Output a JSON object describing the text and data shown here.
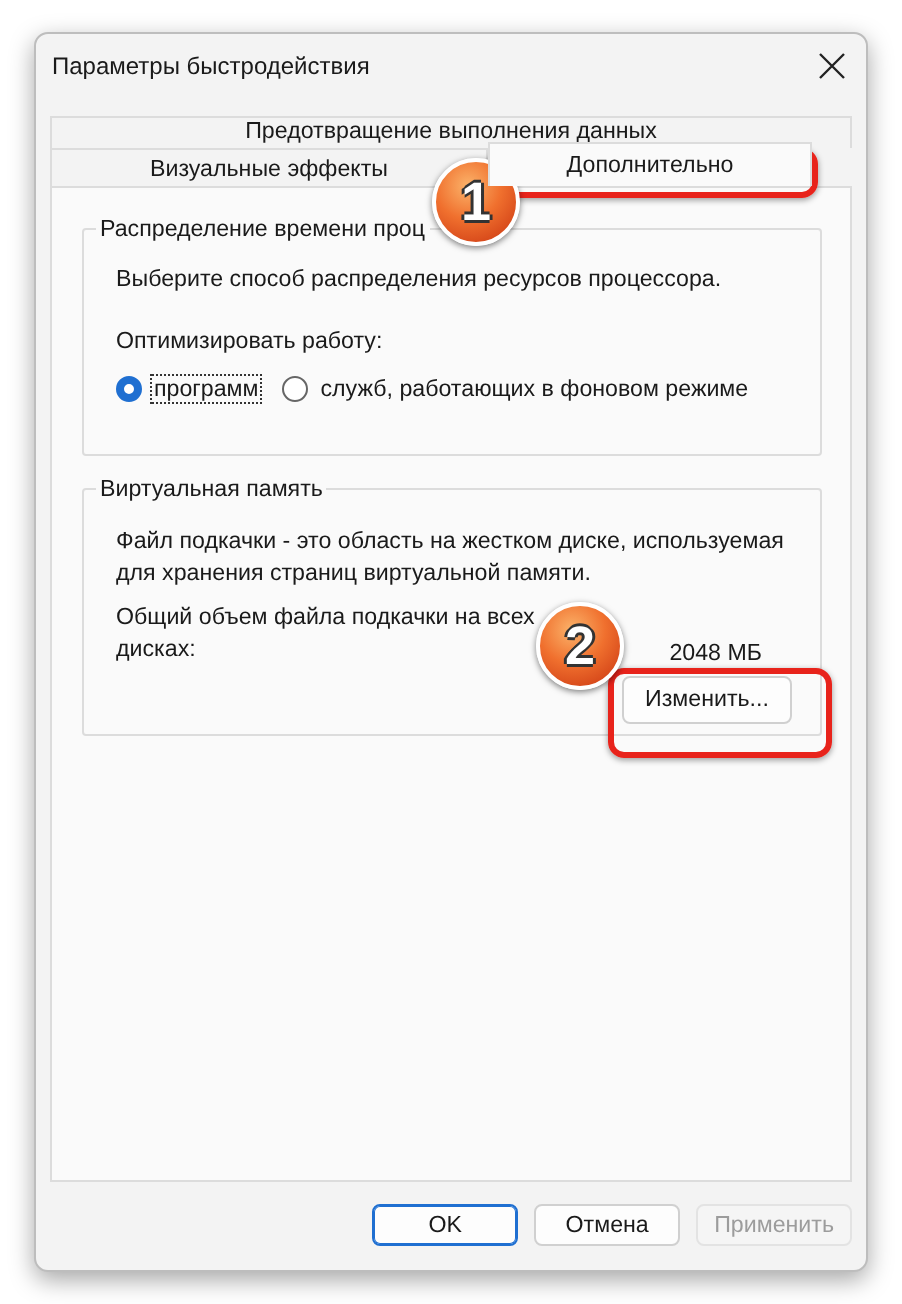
{
  "window": {
    "title": "Параметры быстродействия"
  },
  "tab_rows": [
    [
      {
        "label": "Предотвращение выполнения данных",
        "selected": false
      }
    ],
    [
      {
        "label": "Визуальные эффекты",
        "selected": false
      },
      {
        "label": "Дополнительно",
        "selected": true
      }
    ]
  ],
  "processor_scheduling": {
    "legend": "Распределение времени проц",
    "description": "Выберите способ распределения ресурсов процессора.",
    "optimize_label": "Оптимизировать работу:",
    "options": [
      {
        "label": "программ",
        "selected": true,
        "focused": true
      },
      {
        "label": "служб, работающих в фоновом режиме",
        "selected": false,
        "focused": false
      }
    ]
  },
  "virtual_memory": {
    "legend": "Виртуальная память",
    "description": "Файл подкачки - это область на жестком диске, используемая для хранения страниц виртуальной памяти.",
    "total_label": "Общий объем файла подкачки на всех дисках:",
    "total_value": "2048 МБ",
    "change_button": "Изменить..."
  },
  "buttons": [
    {
      "label": "OK",
      "default": true,
      "disabled": false
    },
    {
      "label": "Отмена",
      "default": false,
      "disabled": false
    },
    {
      "label": "Применить",
      "default": false,
      "disabled": true
    }
  ],
  "annotations": [
    {
      "number": "1"
    },
    {
      "number": "2"
    }
  ]
}
